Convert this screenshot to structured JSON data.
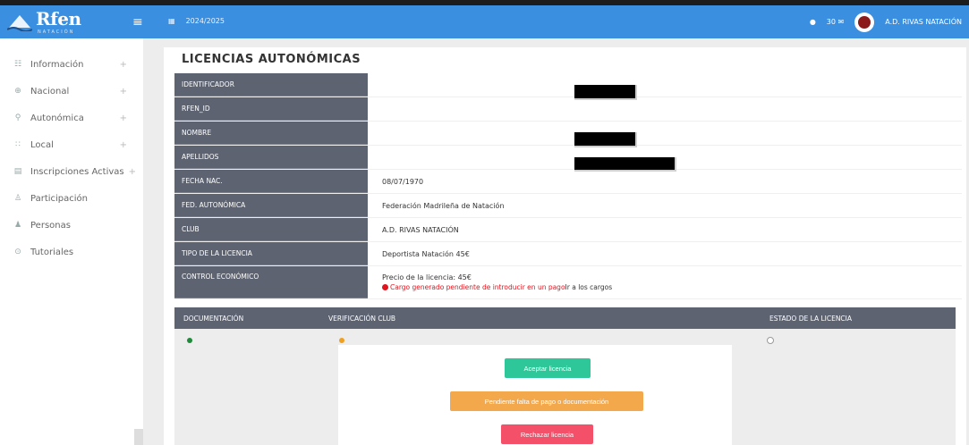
{
  "app": {
    "brand": "Rfen",
    "brand_sub": "NATACIÓN",
    "season": "2024/2025"
  },
  "header": {
    "notifications": "",
    "count": "30",
    "user": "A.D. RIVAS NATACIÓN"
  },
  "sidebar": {
    "items": [
      {
        "icon": "info-icon",
        "label": "Información",
        "has_sub": true
      },
      {
        "icon": "globe-icon",
        "label": "Nacional",
        "has_sub": true
      },
      {
        "icon": "map-icon",
        "label": "Autonómica",
        "has_sub": true
      },
      {
        "icon": "pin-icon",
        "label": "Local",
        "has_sub": true
      },
      {
        "icon": "clipboard-icon",
        "label": "Inscripciones Activas",
        "has_sub": true
      },
      {
        "icon": "person-icon",
        "label": "Participación",
        "has_sub": false
      },
      {
        "icon": "people-icon",
        "label": "Personas",
        "has_sub": false
      },
      {
        "icon": "book-icon",
        "label": "Tutoriales",
        "has_sub": false
      }
    ]
  },
  "main": {
    "title": "LICENCIAS AUTONÓMICAS",
    "rows": [
      {
        "label": "IDENTIFICADOR",
        "value": ""
      },
      {
        "label": "RFEN_ID",
        "value": ""
      },
      {
        "label": "NOMBRE",
        "value": ""
      },
      {
        "label": "APELLIDOS",
        "value": ""
      },
      {
        "label": "FECHA NAC.",
        "value": "08/07/1970"
      },
      {
        "label": "FED. AUTONÓMICA",
        "value": "Federación Madrileña de Natación"
      },
      {
        "label": "CLUB",
        "value": "A.D. RIVAS NATACIÓN"
      },
      {
        "label": "TIPO DE LA LICENCIA",
        "value": "Deportista Natación 45€"
      }
    ],
    "economic": {
      "label": "CONTROL ECONÓMICO",
      "price": "Precio de la licencia: 45€",
      "warning": "Cargo generado pendiente de introducir en un pago",
      "link": "Ir a los cargos"
    },
    "documentation": {
      "col1": "DOCUMENTACIÓN",
      "col2": "VERIFICACIÓN CLUB",
      "col3": "ESTADO DE LA LICENCIA"
    },
    "buttons": {
      "accept": "Aceptar licencia",
      "pending": "Pendiente falta de pago o documentación",
      "reject": "Rechazar licencia"
    }
  },
  "colors": {
    "navbar": "#3b8fe0",
    "label_bg": "#5d6371",
    "accept": "#2ec79a",
    "pending": "#f3a94b",
    "reject": "#f4506a",
    "dot_green": "#1e8a3a",
    "dot_orange": "#f0a020",
    "warn": "#e4141e"
  }
}
